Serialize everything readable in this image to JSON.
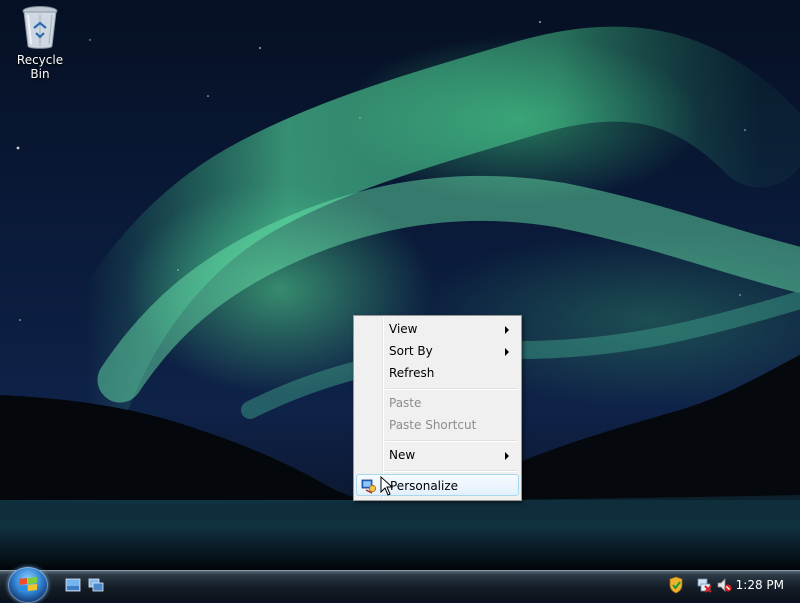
{
  "desktop": {
    "icons": [
      {
        "label": "Recycle Bin",
        "icon": "recycle-bin-icon"
      }
    ]
  },
  "context_menu": {
    "items": [
      {
        "label": "View",
        "submenu": true,
        "enabled": true
      },
      {
        "label": "Sort By",
        "submenu": true,
        "enabled": true
      },
      {
        "label": "Refresh",
        "submenu": false,
        "enabled": true
      },
      {
        "label": "Paste",
        "submenu": false,
        "enabled": false
      },
      {
        "label": "Paste Shortcut",
        "submenu": false,
        "enabled": false
      },
      {
        "label": "New",
        "submenu": true,
        "enabled": true
      },
      {
        "label": "Personalize",
        "submenu": false,
        "enabled": true,
        "highlighted": true,
        "icon": "personalize-icon"
      }
    ]
  },
  "taskbar": {
    "start_icon": "windows-start-icon",
    "quick_launch": [
      {
        "icon": "show-desktop-icon"
      },
      {
        "icon": "switch-windows-icon"
      }
    ],
    "tray": [
      {
        "icon": "security-shield-icon"
      },
      {
        "icon": "network-disconnected-icon"
      },
      {
        "icon": "volume-muted-icon"
      }
    ],
    "clock": "1:28 PM"
  },
  "colors": {
    "aurora": "#4fd38f",
    "menu_highlight": "#e3f0fb",
    "taskbar": "#16202a"
  }
}
